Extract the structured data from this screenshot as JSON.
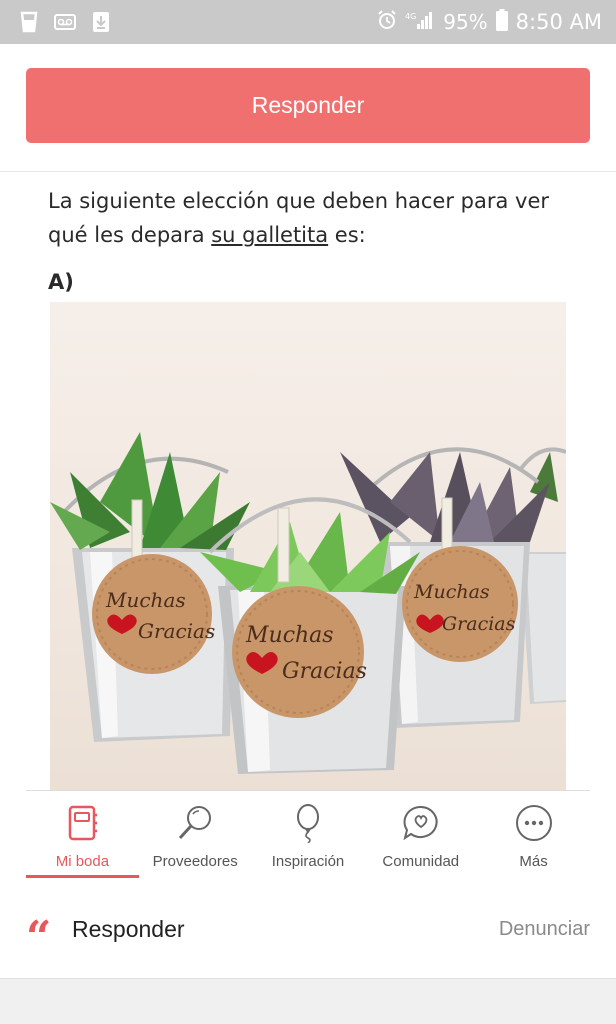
{
  "status_bar": {
    "battery": "95%",
    "time": "8:50 AM",
    "icons": [
      "cup-icon",
      "voicemail-icon",
      "download-icon",
      "alarm-icon",
      "signal-icon",
      "battery-icon"
    ]
  },
  "top_button": {
    "label": "Responder"
  },
  "post": {
    "text_before": "La siguiente elección que deben hacer para ver qué les depara ",
    "link_text": "su galletita",
    "text_after": " es:",
    "option_label": "A)"
  },
  "photo": {
    "tag_line1": "Muchas",
    "tag_line2": "Gracias"
  },
  "bottom_nav": {
    "items": [
      {
        "label": "Mi boda",
        "icon": "notebook-icon"
      },
      {
        "label": "Proveedores",
        "icon": "magnifier-icon"
      },
      {
        "label": "Inspiración",
        "icon": "balloon-icon"
      },
      {
        "label": "Comunidad",
        "icon": "chat-heart-icon"
      },
      {
        "label": "Más",
        "icon": "more-icon"
      }
    ]
  },
  "reply_row": {
    "quote_glyph": "“",
    "label": "Responder",
    "report": "Denunciar"
  },
  "colors": {
    "accent": "#f07070",
    "active": "#e8575c",
    "statusbar": "#c9c9c9"
  }
}
